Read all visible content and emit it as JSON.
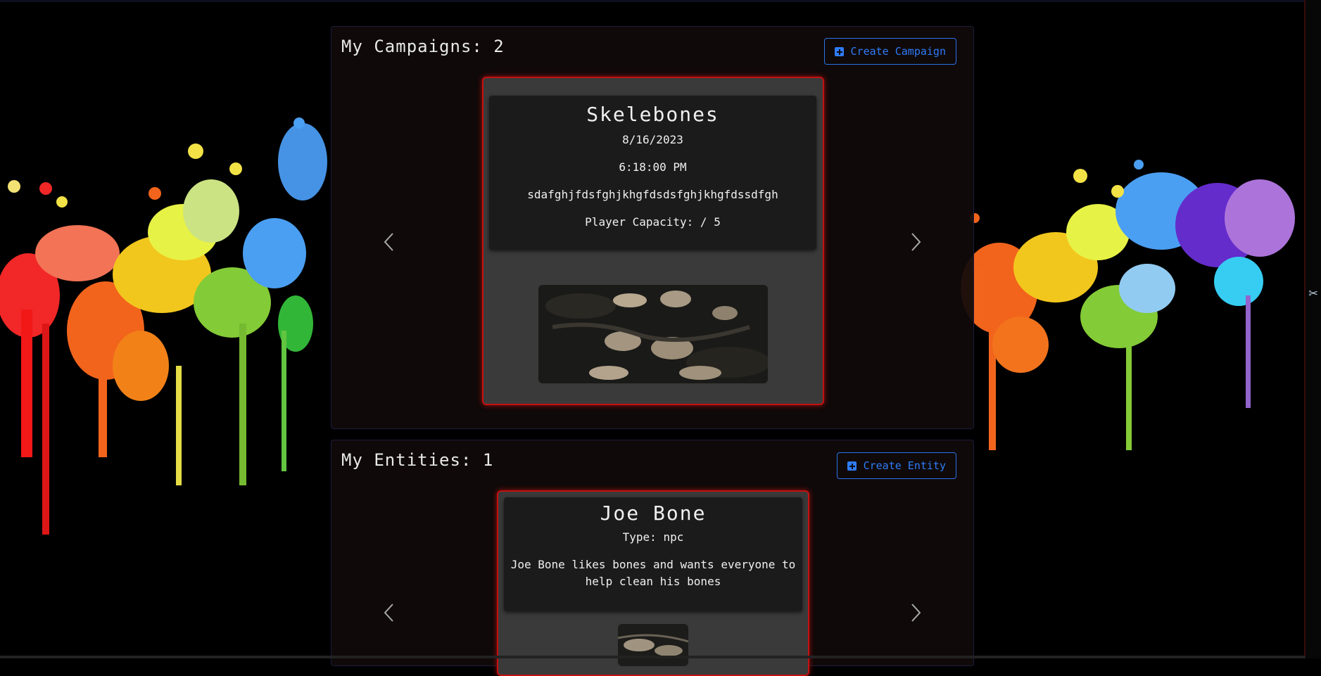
{
  "campaigns": {
    "title": "My Campaigns: 2",
    "create_label": "Create Campaign",
    "card": {
      "name": "Skelebones",
      "date": "8/16/2023",
      "time": "6:18:00 PM",
      "description": "sdafghjfdsfghjkhgfdsdsfghjkhgfdssdfgh",
      "capacity": "Player Capacity: / 5"
    }
  },
  "entities": {
    "title": "My Entities: 1",
    "create_label": "Create Entity",
    "card": {
      "name": "Joe Bone",
      "type": "Type: npc",
      "description": "Joe Bone likes bones and wants everyone to help clean his bones"
    }
  },
  "icons": {
    "create": "plus-square-icon",
    "prev": "chevron-left-icon",
    "next": "chevron-right-icon",
    "rail": "scissors-icon"
  },
  "colors": {
    "accent_blue": "#2f7cf6",
    "card_border": "#c41010",
    "background": "#000000"
  }
}
